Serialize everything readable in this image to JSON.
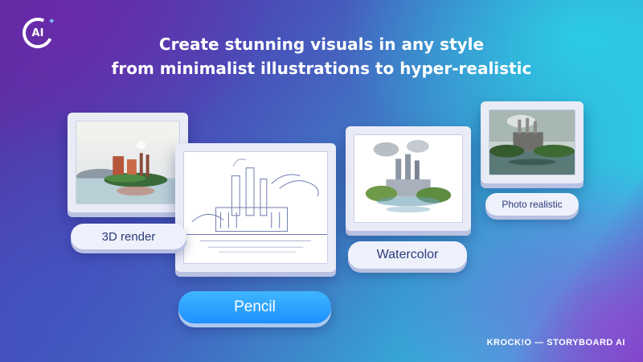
{
  "logo": {
    "text": "AI"
  },
  "headline": {
    "line1": "Create stunning visuals in any style",
    "line2": "from minimalist illustrations to hyper-realistic"
  },
  "styles": [
    {
      "id": "3d-render",
      "label": "3D render"
    },
    {
      "id": "pencil",
      "label": "Pencil",
      "selected": true
    },
    {
      "id": "watercolor",
      "label": "Watercolor"
    },
    {
      "id": "photo-realistic",
      "label": "Photo realistic"
    }
  ],
  "brand": {
    "text": "KROCK!O — STORYBOARD AI"
  },
  "colors": {
    "accent": "#1e90ff",
    "card": "#e9ecf7",
    "label_text": "#2b3a7a"
  },
  "icons": [
    "ai-logo-icon"
  ]
}
